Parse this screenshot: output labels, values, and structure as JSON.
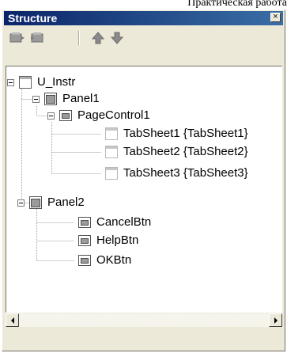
{
  "document_header": {
    "text": "Практическая работа"
  },
  "panel": {
    "title": "Structure",
    "close_label": "×"
  },
  "toolbar": {
    "buttons": [
      {
        "icon": "add-component-icon"
      },
      {
        "icon": "remove-component-icon"
      },
      {
        "icon": "arrow-up-icon"
      },
      {
        "icon": "arrow-down-icon"
      }
    ]
  },
  "tree": {
    "nodes": [
      {
        "label": "U_Instr",
        "level": 0,
        "expanded": true,
        "icon": "form-icon"
      },
      {
        "label": "Panel1",
        "level": 1,
        "expanded": true,
        "icon": "panel-icon"
      },
      {
        "label": "PageControl1",
        "level": 2,
        "expanded": true,
        "icon": "pagecontrol-icon"
      },
      {
        "label": "TabSheet1 {TabSheet1}",
        "level": 3,
        "icon": "tabsheet-icon"
      },
      {
        "label": "TabSheet2 {TabSheet2}",
        "level": 3,
        "icon": "tabsheet-icon"
      },
      {
        "label": "TabSheet3 {TabSheet3}",
        "level": 3,
        "icon": "tabsheet-icon"
      },
      {
        "label": "Panel2",
        "level": 1,
        "expanded": true,
        "icon": "panel-icon"
      },
      {
        "label": "CancelBtn",
        "level": 2,
        "icon": "button-component-icon"
      },
      {
        "label": "HelpBtn",
        "level": 2,
        "icon": "button-component-icon"
      },
      {
        "label": "OKBtn",
        "level": 2,
        "icon": "button-component-icon"
      }
    ]
  },
  "scrollbar": {
    "left_arrow": "◀",
    "right_arrow": "▶"
  }
}
